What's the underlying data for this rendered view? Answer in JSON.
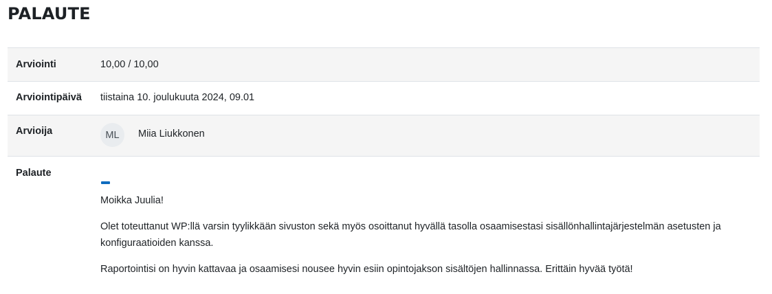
{
  "page": {
    "heading": "PALAUTE"
  },
  "rows": {
    "grade": {
      "label": "Arviointi",
      "value": "10,00 / 10,00"
    },
    "graded_on": {
      "label": "Arviointipäivä",
      "value": "tiistaina 10. joulukuuta 2024, 09.01"
    },
    "grader": {
      "label": "Arvioija",
      "initials": "ML",
      "name": "Miia Liukkonen"
    },
    "feedback": {
      "label": "Palaute",
      "paragraphs": [
        "Moikka Juulia!",
        "Olet toteuttanut WP:llä varsin tyylikkään sivuston sekä myös osoittanut hyvällä tasolla osaamisestasi sisällönhallintajärjestelmän asetusten ja konfiguraatioiden kanssa.",
        "Raportointisi on hyvin kattavaa ja osaamisesi nousee hyvin esiin opintojakson sisältöjen hallinnassa. Erittäin hyvää työtä!"
      ]
    }
  },
  "colors": {
    "accent": "#0f6cbf",
    "shaded_row": "#f5f5f5",
    "border": "#dee2e6",
    "text": "#1d2125"
  }
}
